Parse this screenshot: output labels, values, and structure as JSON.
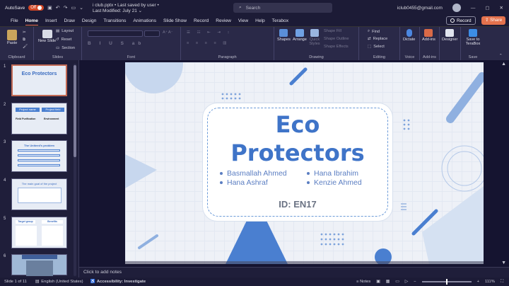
{
  "titlebar": {
    "autosave_label": "AutoSave",
    "autosave_state": "Off",
    "document_title": "i club.pptx",
    "save_status": "Last saved by user",
    "last_modified": "Last Modified: July 21",
    "search_placeholder": "Search",
    "account_email": "iclub0455@gmail.com"
  },
  "menu": {
    "items": [
      "File",
      "Home",
      "Insert",
      "Draw",
      "Design",
      "Transitions",
      "Animations",
      "Slide Show",
      "Record",
      "Review",
      "View",
      "Help",
      "Terabox"
    ],
    "active": "Home",
    "record_label": "Record",
    "share_label": "Share"
  },
  "ribbon": {
    "clipboard": {
      "paste": "Paste",
      "label": "Clipboard"
    },
    "slides": {
      "new_slide": "New Slide",
      "layout": "Layout",
      "reset": "Reset",
      "section": "Section",
      "label": "Slides"
    },
    "font": {
      "label": "Font"
    },
    "paragraph": {
      "label": "Paragraph"
    },
    "drawing": {
      "shapes": "Shapes",
      "arrange": "Arrange",
      "quick_styles": "Quick Styles",
      "shape_fill": "Shape Fill",
      "shape_outline": "Shape Outline",
      "shape_effects": "Shape Effects",
      "label": "Drawing"
    },
    "editing": {
      "find": "Find",
      "replace": "Replace",
      "select": "Select",
      "label": "Editing"
    },
    "voice": {
      "dictate": "Dictate",
      "label": "Voice"
    },
    "addins": {
      "addins": "Add-ins",
      "label": "Add-ins"
    },
    "designer": {
      "designer": "Designer"
    },
    "save": {
      "save_to_terabox": "Save to TeraBox",
      "label": "Save"
    }
  },
  "thumbnails": [
    {
      "num": "1",
      "caption": "Eco Protectors"
    },
    {
      "num": "2",
      "caption": "Project name"
    },
    {
      "num": "3",
      "caption": "The Uniteed's problem"
    },
    {
      "num": "4",
      "caption": "The main goal of the project"
    },
    {
      "num": "5",
      "caption": "Target group"
    },
    {
      "num": "6",
      "caption": ""
    }
  ],
  "thumb_extra": {
    "project_field": "Project field",
    "field_purification": "Field Purification",
    "environment": "Environment",
    "benefits": "Benefits"
  },
  "slide": {
    "title_line1": "Eco",
    "title_line2": "Protectors",
    "members_left": [
      "Basmallah Ahmed",
      "Hana Ashraf"
    ],
    "members_right": [
      "Hana Ibrahim",
      "Kenzie Ahmed"
    ],
    "id_text": "ID: EN17"
  },
  "notes_placeholder": "Click to add notes",
  "statusbar": {
    "slide_counter": "Slide 1 of 11",
    "language": "English (United States)",
    "accessibility": "Accessibility: Investigate",
    "notes_label": "Notes",
    "zoom": "111%"
  },
  "colors": {
    "accent": "#e4724d",
    "slide_blue": "#3f74c8"
  }
}
